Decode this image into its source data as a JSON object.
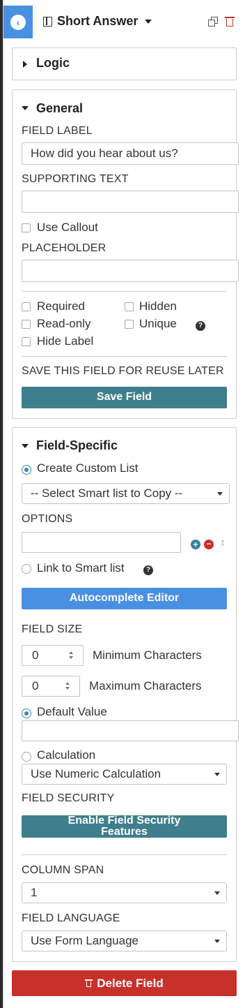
{
  "header": {
    "title": "Short Answer",
    "back_icon": "chevron-left-icon",
    "duplicate_icon": "duplicate-icon",
    "delete_icon": "trash-icon"
  },
  "logic": {
    "title": "Logic"
  },
  "general": {
    "title": "General",
    "field_label_heading": "FIELD LABEL",
    "field_label_value": "How did you hear about us?",
    "supporting_text_heading": "SUPPORTING TEXT",
    "supporting_text_value": "",
    "use_callout_label": "Use Callout",
    "placeholder_heading": "PLACEHOLDER",
    "placeholder_value": "",
    "options": {
      "required": "Required",
      "hidden": "Hidden",
      "read_only": "Read-only",
      "unique": "Unique",
      "hide_label": "Hide Label"
    },
    "save_heading": "SAVE THIS FIELD FOR REUSE LATER",
    "save_button": "Save Field"
  },
  "field_specific": {
    "title": "Field-Specific",
    "create_custom_list": "Create Custom List",
    "smart_list_select": "-- Select Smart list to Copy --",
    "options_heading": "OPTIONS",
    "options_value": "",
    "link_smart_list": "Link to Smart list",
    "autocomplete_button": "Autocomplete Editor",
    "field_size_heading": "FIELD SIZE",
    "min_value": "0",
    "min_label": "Minimum Characters",
    "max_value": "0",
    "max_label": "Maximum Characters",
    "default_value_label": "Default Value",
    "default_value_input": "",
    "calculation_label": "Calculation",
    "calculation_select": "Use Numeric Calculation",
    "field_security_heading": "FIELD SECURITY",
    "field_security_button": "Enable Field Security Features",
    "column_span_heading": "COLUMN SPAN",
    "column_span_value": "1",
    "field_language_heading": "FIELD LANGUAGE",
    "field_language_value": "Use Form Language"
  },
  "delete_button": "Delete Field",
  "colors": {
    "accent_blue": "#4a90e2",
    "teal_button": "#3f7e8c",
    "danger": "#c8302a"
  }
}
